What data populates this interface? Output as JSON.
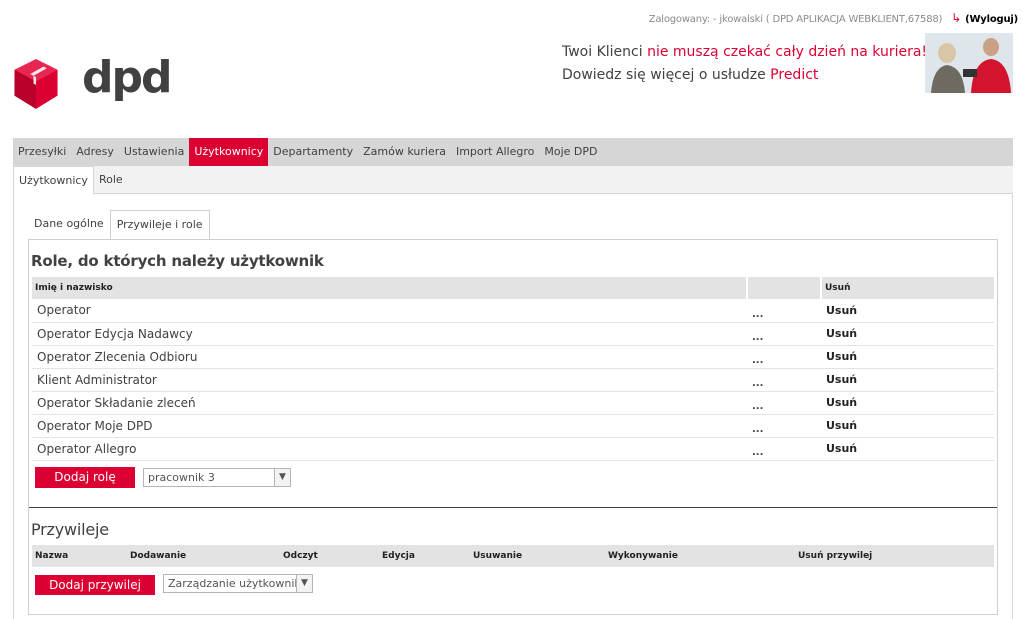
{
  "header": {
    "login_label": "Zalogowany:",
    "login_user": "- jkowalski ( DPD APLIKACJA WEBKLIENT,67588)",
    "logout_label": "(Wyloguj)",
    "logo_text": "dpd",
    "promo_line1_a": "Twoi Klienci ",
    "promo_line1_b": "nie muszą czekać cały dzień na kuriera!",
    "promo_line2_a": "Dowiedz się więcej o usłudze ",
    "promo_line2_b": "Predict"
  },
  "main_nav": [
    "Przesyłki",
    "Adresy",
    "Ustawienia",
    "Użytkownicy",
    "Departamenty",
    "Zamów kuriera",
    "Import Allegro",
    "Moje DPD"
  ],
  "sub_nav": [
    "Użytkownicy",
    "Role"
  ],
  "tabs": [
    "Dane ogólne",
    "Przywileje i role"
  ],
  "roles_section": {
    "title": "Role, do których należy użytkownik",
    "col_name": "Imię i nazwisko",
    "col_delete": "Usuń",
    "rows": [
      {
        "name": "Operator",
        "dots": "...",
        "delete": "Usuń"
      },
      {
        "name": "Operator Edycja Nadawcy",
        "dots": "...",
        "delete": "Usuń"
      },
      {
        "name": "Operator Zlecenia Odbioru",
        "dots": "...",
        "delete": "Usuń"
      },
      {
        "name": "Klient Administrator",
        "dots": "...",
        "delete": "Usuń"
      },
      {
        "name": "Operator Składanie zleceń",
        "dots": "...",
        "delete": "Usuń"
      },
      {
        "name": "Operator Moje DPD",
        "dots": "...",
        "delete": "Usuń"
      },
      {
        "name": "Operator Allegro",
        "dots": "...",
        "delete": "Usuń"
      }
    ],
    "add_button": "Dodaj rolę",
    "select_value": "pracownik 3"
  },
  "privileges_section": {
    "title": "Przywileje",
    "columns": [
      "Nazwa",
      "Dodawanie",
      "Odczyt",
      "Edycja",
      "Usuwanie",
      "Wykonywanie",
      "Usuń przywilej"
    ],
    "add_button": "Dodaj przywilej",
    "select_value": "Zarządzanie użytkownikami"
  },
  "colors": {
    "brand_red": "#dc0032",
    "text": "#414042"
  }
}
